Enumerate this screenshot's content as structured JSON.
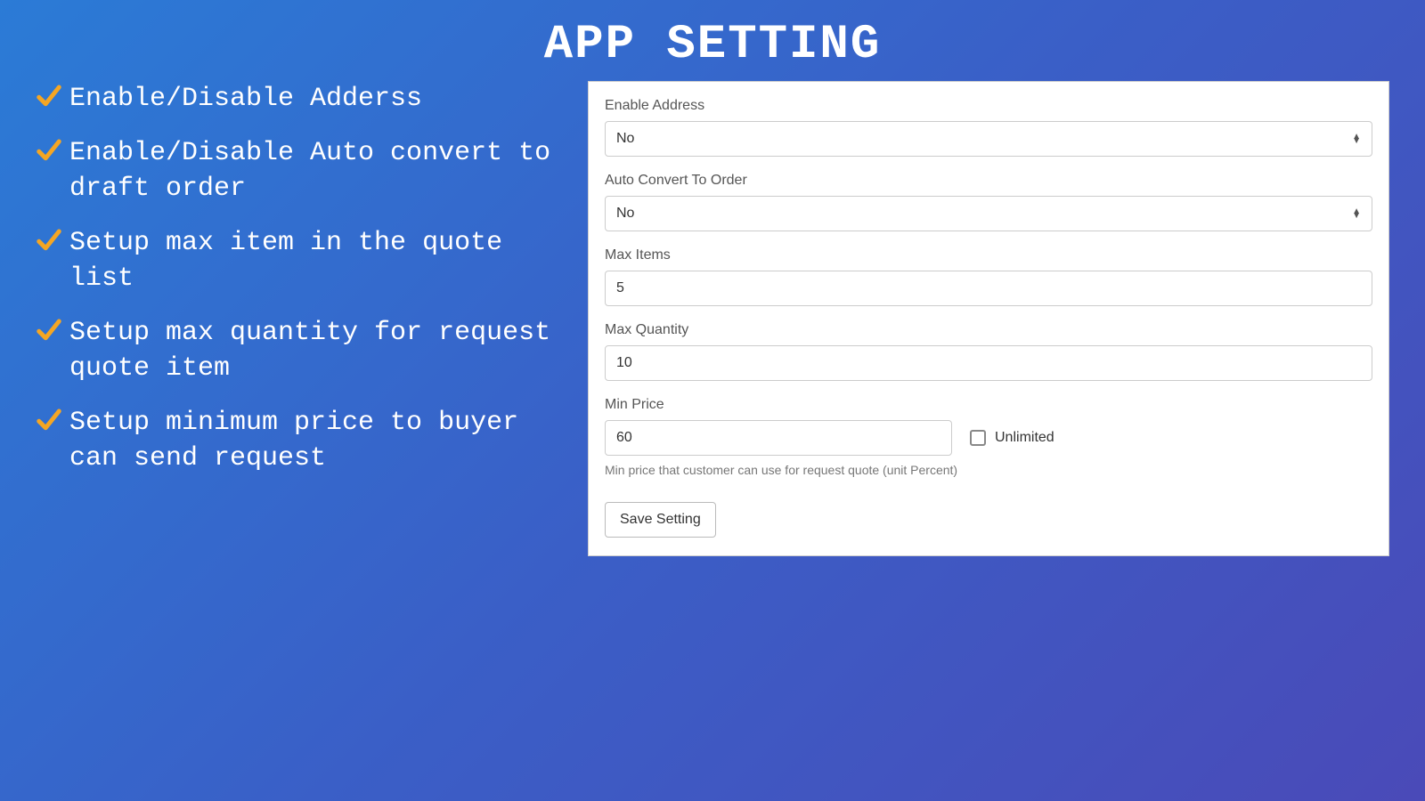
{
  "title": "APP SETTING",
  "bullets": [
    "Enable/Disable Adderss",
    "Enable/Disable Auto convert to draft order",
    "Setup max item in the quote list",
    "Setup max quantity for request quote item",
    "Setup minimum price to buyer can send request"
  ],
  "form": {
    "enable_address": {
      "label": "Enable Address",
      "value": "No"
    },
    "auto_convert": {
      "label": "Auto Convert To Order",
      "value": "No"
    },
    "max_items": {
      "label": "Max Items",
      "value": "5"
    },
    "max_quantity": {
      "label": "Max Quantity",
      "value": "10"
    },
    "min_price": {
      "label": "Min Price",
      "value": "60",
      "unlimited_label": "Unlimited",
      "help": "Min price that customer can use for request quote (unit Percent)"
    },
    "save_button": "Save Setting"
  },
  "colors": {
    "check": "#f5a623"
  }
}
